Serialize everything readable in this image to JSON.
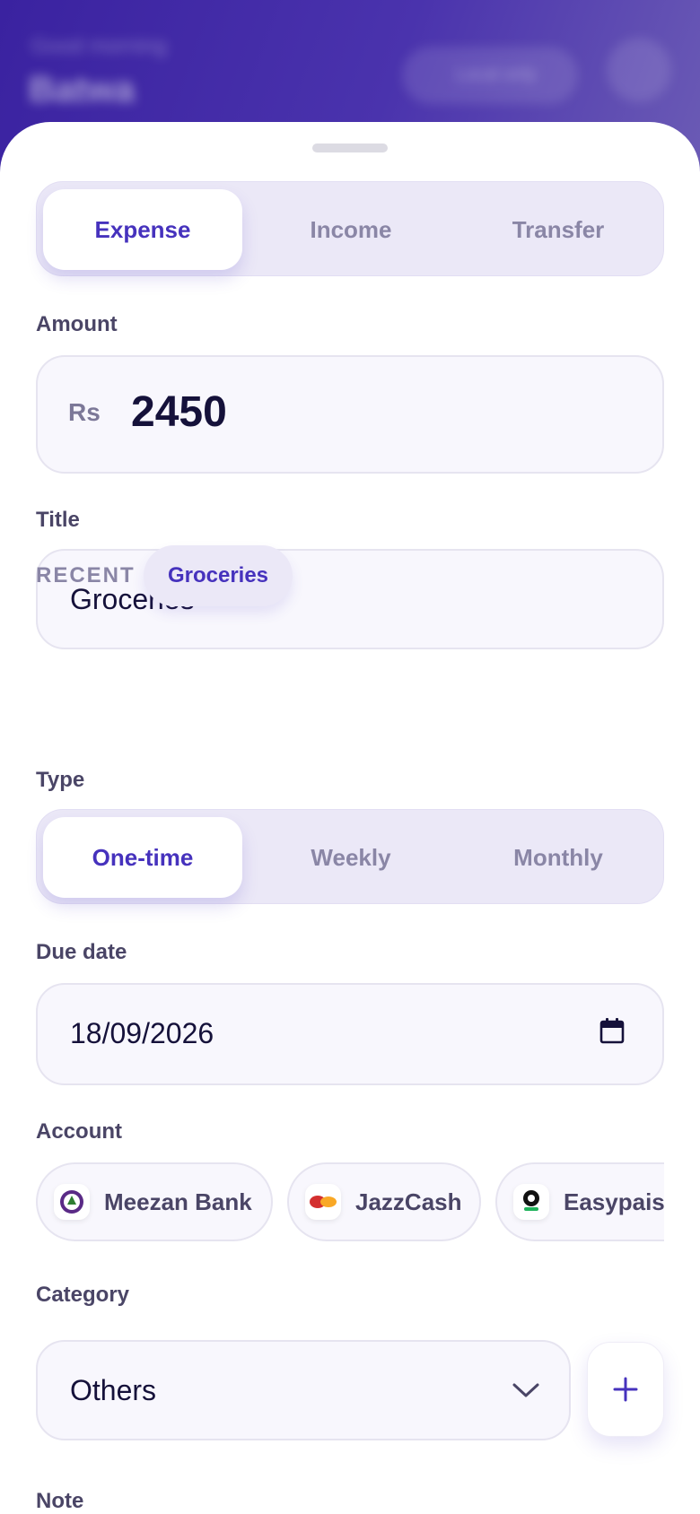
{
  "header": {
    "greeting": "Good morning",
    "name": "Batwa",
    "pill_label": "Local only"
  },
  "tabs": {
    "items": [
      "Expense",
      "Income",
      "Transfer"
    ],
    "active": "Expense"
  },
  "amount": {
    "label": "Amount",
    "currency": "Rs",
    "value": "2450"
  },
  "title": {
    "label": "Title",
    "value": "Groceries"
  },
  "recent": {
    "label": "RECENT",
    "chip": "Groceries"
  },
  "type": {
    "label": "Type",
    "items": [
      "One-time",
      "Weekly",
      "Monthly"
    ],
    "active": "One-time"
  },
  "due_date": {
    "label": "Due date",
    "value": "18/09/2026"
  },
  "account": {
    "label": "Account",
    "items": [
      "Meezan Bank",
      "JazzCash",
      "Easypaisa"
    ]
  },
  "category": {
    "label": "Category",
    "value": "Others"
  },
  "note": {
    "label": "Note"
  },
  "colors": {
    "accent": "#4632bd",
    "header": "#3a22a0",
    "segment_bg": "#ebe8f7",
    "field_bg": "#f8f7fd"
  },
  "icons": [
    "calendar-icon",
    "chevron-down-icon",
    "plus-icon",
    "meezan-logo",
    "jazzcash-logo",
    "easypaisa-logo"
  ]
}
